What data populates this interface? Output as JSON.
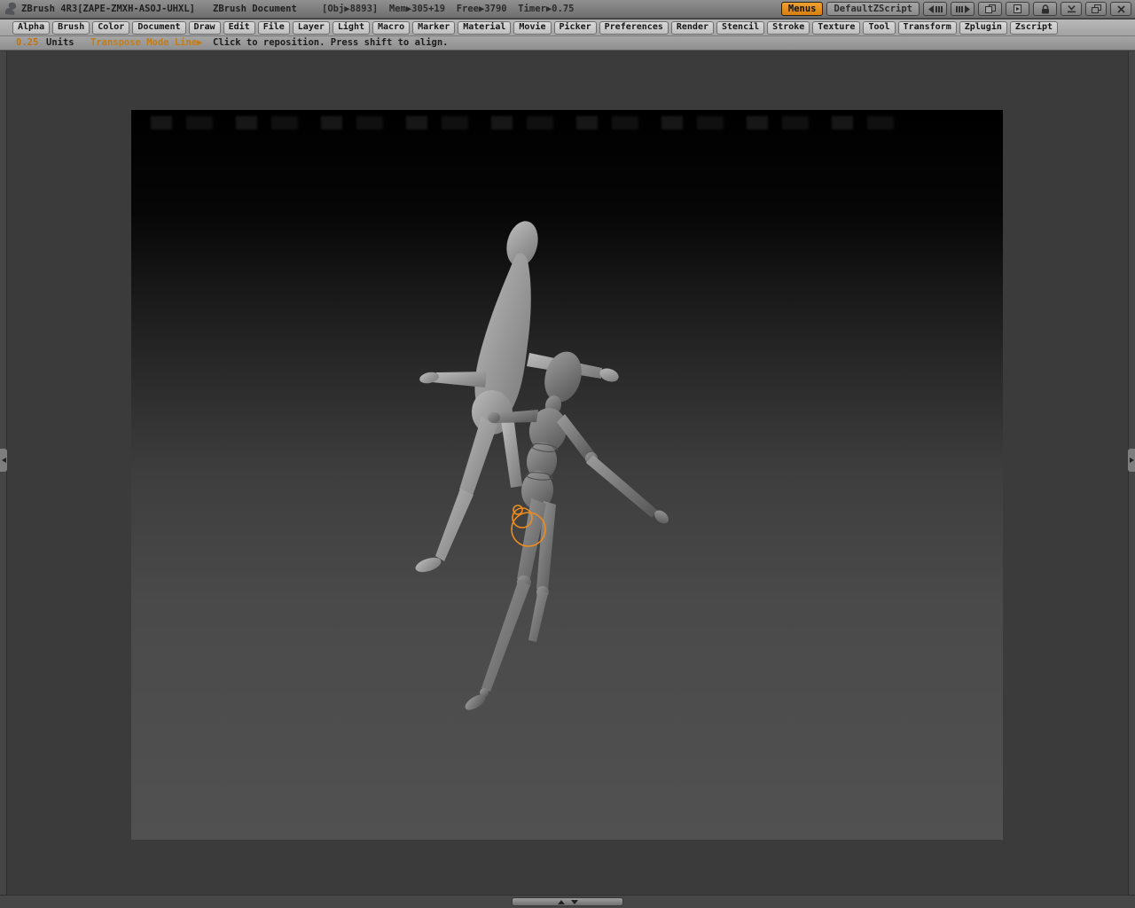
{
  "colors": {
    "transpose_gizmo": "#ee8d1e",
    "accent_orange": "#d0821c",
    "canvas_background": "#3b3b3b"
  },
  "title_bar": {
    "app_title": "ZBrush 4R3[ZAPE-ZMXH-ASOJ-UHXL]",
    "document_title": "ZBrush Document",
    "stats": "[Obj▶8893]  Mem▶305+19  Free▶3790  Timer▶0.75",
    "menus_button": "Menus",
    "zscript_button": "DefaultZScript",
    "icon_buttons": [
      "tray-scroll-left",
      "tray-scroll-right",
      "document-copy",
      "document-export",
      "lock",
      "minimize",
      "restore",
      "close"
    ]
  },
  "menu_bar": {
    "items": [
      "Alpha",
      "Brush",
      "Color",
      "Document",
      "Draw",
      "Edit",
      "File",
      "Layer",
      "Light",
      "Macro",
      "Marker",
      "Material",
      "Movie",
      "Picker",
      "Preferences",
      "Render",
      "Stencil",
      "Stroke",
      "Texture",
      "Tool",
      "Transform",
      "Zplugin",
      "Zscript"
    ]
  },
  "status_bar": {
    "units_value": "0.25",
    "units_label": "Units",
    "mode_label": "Transpose Mode Line▶",
    "hint": "Click to reposition. Press shift to align."
  },
  "scene": {
    "objects": [
      "background-mannequin",
      "foreground-mannequin"
    ],
    "gizmo": "transpose-rings"
  }
}
